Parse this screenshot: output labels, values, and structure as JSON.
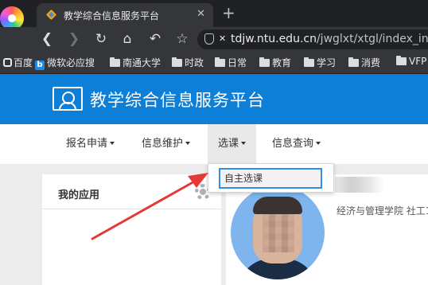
{
  "browser": {
    "tab_title": "教学综合信息服务平台",
    "tab_close_glyph": "✕",
    "new_tab_glyph": "+",
    "url_host": "tdjw.ntu.edu.cn",
    "url_path": "/jwglxt/xtgl/index_in",
    "bookmarks": [
      "百度",
      "微软必应搜",
      "南通大学",
      "时政",
      "日常",
      "教育",
      "学习",
      "消费",
      "VFP"
    ]
  },
  "site": {
    "title": "教学综合信息服务平台",
    "nav": [
      "报名申请",
      "信息维护",
      "选课",
      "信息查询"
    ],
    "active_nav": "选课",
    "dropdown_item": "自主选课"
  },
  "panels": {
    "apps_title": "我的应用",
    "user_dept": "经济与管理学院 社工1"
  },
  "colors": {
    "header_blue": "#0e7fd7",
    "highlight_border": "#2e8ee6",
    "arrow_red": "#e53935"
  },
  "icons": [
    "browser-logo-icon",
    "back-icon",
    "forward-icon",
    "reload-icon",
    "home-icon",
    "undo-icon",
    "star-icon",
    "gear-icon",
    "platform-logo-icon"
  ]
}
